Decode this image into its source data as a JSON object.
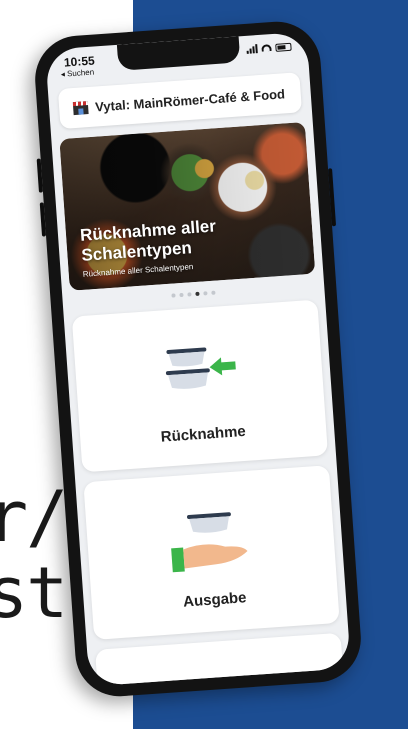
{
  "background": {
    "edge_text_line1": "r/",
    "edge_text_line2": "st",
    "panel_color": "#1c4d92"
  },
  "status_bar": {
    "time": "10:55",
    "back_label": "◂ Suchen"
  },
  "header": {
    "title": "Vytal: MainRömer-Café & Food"
  },
  "banner": {
    "title": "Rücknahme aller Schalentypen",
    "subtitle": "Rücknahme aller Schalentypen"
  },
  "carousel": {
    "page_count": 6,
    "active_index": 3
  },
  "actions": [
    {
      "label": "Rücknahme",
      "icon": "return-bowl-icon"
    },
    {
      "label": "Ausgabe",
      "icon": "hand-bowl-icon"
    }
  ],
  "colors": {
    "accent_green": "#3bb54a",
    "bowl_dark": "#2e3b4e",
    "bowl_light": "#d7dde6",
    "hand": "#f2b88d"
  }
}
